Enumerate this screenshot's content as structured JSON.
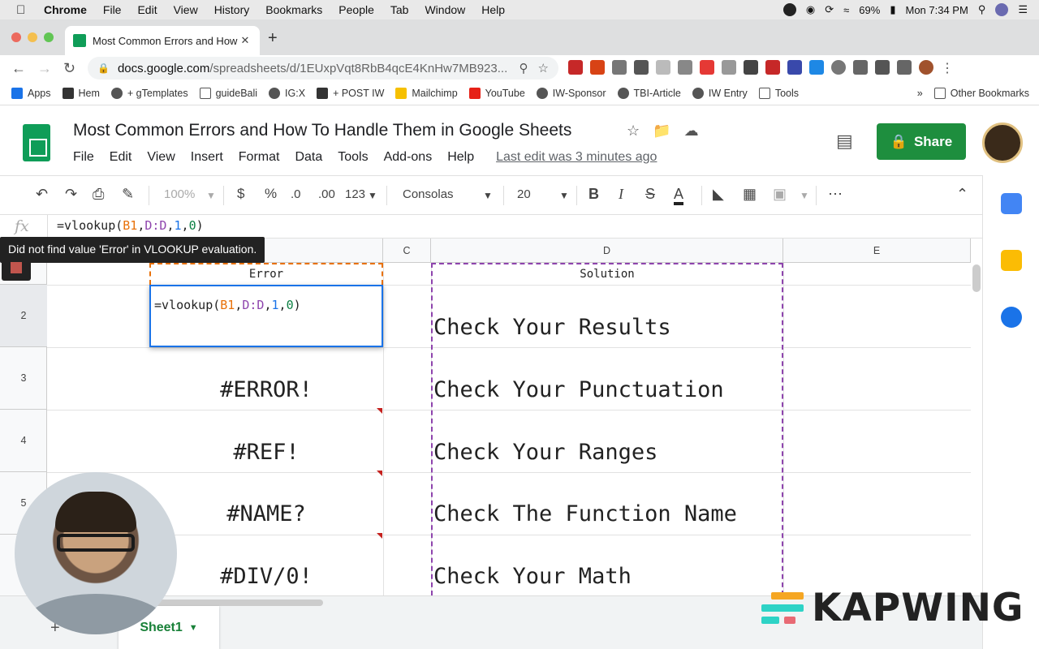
{
  "mac_menubar": {
    "app": "Chrome",
    "items": [
      "File",
      "Edit",
      "View",
      "History",
      "Bookmarks",
      "People",
      "Tab",
      "Window",
      "Help"
    ],
    "battery": "69%",
    "clock": "Mon 7:34 PM"
  },
  "browser": {
    "tab_title": "Most Common Errors and How",
    "url_domain": "docs.google.com",
    "url_path": "/spreadsheets/d/1EUxpVqt8RbB4qcE4KnHw7MB923...",
    "bookmarks": [
      "Apps",
      "Hem",
      "+ gTemplates",
      "guideBali",
      "IG:X",
      "+ POST IW",
      "Mailchimp",
      "YouTube",
      "IW-Sponsor",
      "TBI-Article",
      "IW Entry",
      "Tools"
    ],
    "bookmarks_more": "»",
    "other_bookmarks": "Other Bookmarks"
  },
  "sheets": {
    "title": "Most Common Errors and How To Handle Them in Google Sheets",
    "menus": [
      "File",
      "Edit",
      "View",
      "Insert",
      "Format",
      "Data",
      "Tools",
      "Add-ons",
      "Help"
    ],
    "last_edit": "Last edit was 3 minutes ago",
    "share_label": "Share",
    "toolbar": {
      "zoom": "100%",
      "currency": "$",
      "percent": "%",
      "dec_less": ".0",
      "dec_more": ".00",
      "format_more": "123",
      "font": "Consolas",
      "font_size": "20",
      "bold": "B",
      "italic": "I",
      "strike": "S",
      "text_color": "A"
    },
    "fx_label": "fx",
    "formula": {
      "p1": "=vlookup(",
      "p2": "B1",
      "p3": ",",
      "p4": "D:D",
      "p5": ",",
      "p6": "1",
      "p7": ",",
      "p8": "0",
      "p9": ")"
    },
    "tooltip": "Did not find value 'Error' in VLOOKUP evaluation.",
    "columns": [
      "C",
      "D",
      "E"
    ],
    "rows": [
      "2",
      "3",
      "4",
      "5"
    ],
    "header_error": "Error",
    "header_solution": "Solution",
    "active_cell": {
      "p1": "=vlookup(",
      "p2": "B1",
      "p3": ",",
      "p4": "D:D",
      "p5": ",",
      "p6": "1",
      "p7": ",",
      "p8": "0",
      "p9": ")"
    },
    "errors": [
      "#ERROR!",
      "#REF!",
      "#NAME?",
      "#DIV/0!"
    ],
    "solutions": [
      "Check Your Results",
      "Check Your Punctuation",
      "Check Your Ranges",
      "Check The Function Name",
      "Check Your Math"
    ],
    "sheet_tab": "Sheet1",
    "add_sheet": "+"
  },
  "watermark": "KAPWING",
  "colors": {
    "share_green": "#1e8e3e",
    "range_orange": "#e8710a",
    "range_purple": "#8e44ad",
    "active_blue": "#1a73e8"
  }
}
